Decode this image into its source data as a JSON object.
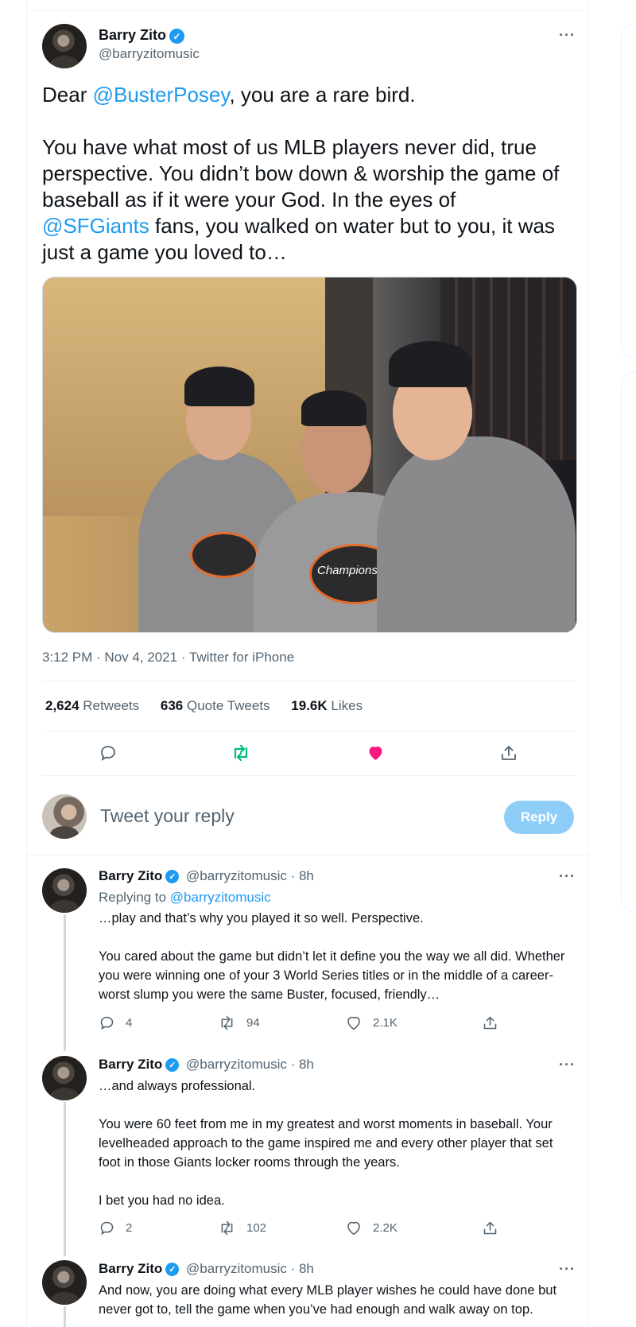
{
  "main_tweet": {
    "author_name": "Barry Zito",
    "author_handle": "@barryzitomusic",
    "text_pre": "Dear ",
    "mention_buster": "@BusterPosey",
    "text_mid1": ", you are a rare bird.\n\nYou have what most of us MLB players never did, true perspective. You didn’t bow down & worship the game of baseball as if it were your God. In the eyes of\n",
    "mention_giants": "@SFGiants",
    "text_mid2": " fans, you walked on water but to you, it was just a game you loved to…",
    "photo_shirt_text": "Champions",
    "meta": "3:12 PM · Nov 4, 2021 · Twitter for iPhone",
    "stats": {
      "retweets_count": "2,624",
      "retweets_label": " Retweets",
      "quotes_count": "636",
      "quotes_label": " Quote Tweets",
      "likes_count": "19.6K",
      "likes_label": " Likes"
    }
  },
  "reply_box": {
    "placeholder": "Tweet your reply",
    "button_label": "Reply"
  },
  "thread": [
    {
      "name": "Barry Zito",
      "handle_time": "@barryzitomusic · 8h",
      "replying_prefix": "Replying to ",
      "replying_handle": "@barryzitomusic",
      "text": "…play and that’s why you played it so well. Perspective.\n\nYou cared about the game but didn’t let it define you the way we all did. Whether you were winning one of your 3 World Series titles or in the middle of a career-worst slump you were the same Buster, focused, friendly…",
      "replies": "4",
      "retweets": "94",
      "likes": "2.1K"
    },
    {
      "name": "Barry Zito",
      "handle_time": "@barryzitomusic · 8h",
      "text": "…and always professional.\n\nYou were 60 feet from me in my greatest and worst moments in baseball. Your levelheaded approach to the game inspired me and every other player that set foot in those Giants locker rooms through the years.\n\nI bet you had no idea.",
      "replies": "2",
      "retweets": "102",
      "likes": "2.2K"
    },
    {
      "name": "Barry Zito",
      "handle_time": "@barryzitomusic · 8h",
      "text": "And now, you are doing what every MLB player wishes he could have done but never got to, tell the game when you’ve had enough and walk away on top."
    }
  ],
  "icons": {
    "reply": "reply-icon",
    "retweet": "retweet-icon",
    "like": "heart-icon",
    "share": "share-icon",
    "more": "more-icon",
    "verified": "verified-badge-icon"
  },
  "colors": {
    "accent": "#1d9bf0",
    "retweet_active": "#00ba7c",
    "like_active": "#f91880",
    "muted": "#536471"
  }
}
